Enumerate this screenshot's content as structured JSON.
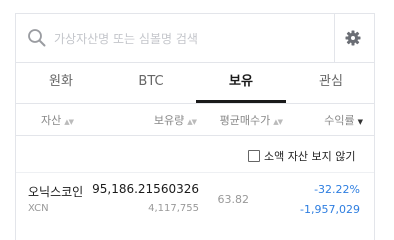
{
  "search": {
    "placeholder": "가상자산명 또는 심볼명 검색"
  },
  "tabs": [
    {
      "label": "원화",
      "active": false
    },
    {
      "label": "BTC",
      "active": false
    },
    {
      "label": "보유",
      "active": true
    },
    {
      "label": "관심",
      "active": false
    }
  ],
  "columns": [
    {
      "label": "자산"
    },
    {
      "label": "보유량"
    },
    {
      "label": "평균매수가"
    },
    {
      "label": "수익률"
    }
  ],
  "hide_small": {
    "label": "소액 자산 보지 않기",
    "checked": false
  },
  "assets": [
    {
      "name": "오닉스코인",
      "ticker": "XCN",
      "quantity": "95,186.21560326",
      "value": "4,117,755",
      "avg_price": "63.82",
      "return_rate": "-32.22%",
      "pnl": "-1,957,029"
    }
  ],
  "colors": {
    "negative": "#2e7ee0",
    "active_tab": "#1a1a1a"
  },
  "icons": {
    "search": "search-icon",
    "settings": "gear-icon",
    "sort": "sort-icon"
  }
}
